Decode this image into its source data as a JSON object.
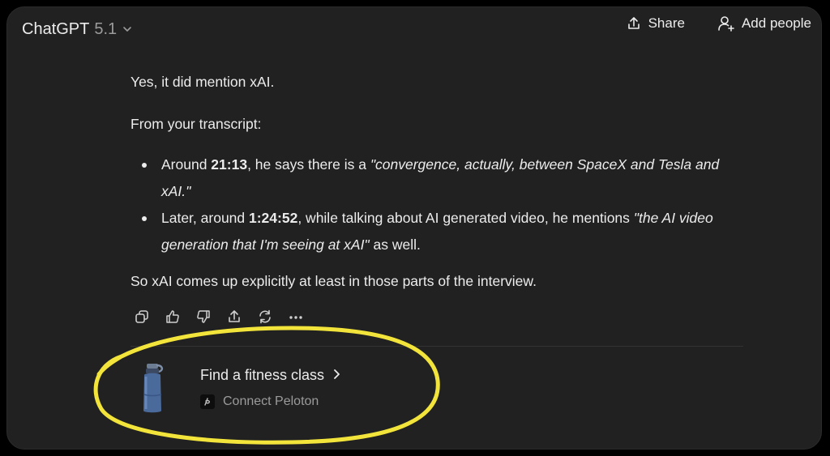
{
  "header": {
    "model_name": "ChatGPT",
    "model_version": "5.1",
    "share_label": "Share",
    "add_people_label": "Add people"
  },
  "message": {
    "p1": "Yes, it did mention xAI.",
    "p2": "From your transcript:",
    "bullets": [
      {
        "prefix": "Around ",
        "time": "21:13",
        "middle": ", he says there is a ",
        "quote": "\"convergence, actually, between SpaceX and Tesla and xAI.\"",
        "suffix": ""
      },
      {
        "prefix": "Later, around ",
        "time": "1:24:52",
        "middle": ", while talking about AI generated video, he mentions ",
        "quote": "\"the AI video generation that I'm seeing at xAI\"",
        "suffix": " as well."
      }
    ],
    "p3": "So xAI comes up explicitly at least in those parts of the interview."
  },
  "actions": [
    "copy-icon",
    "thumbs-up-icon",
    "thumbs-down-icon",
    "share-icon",
    "regenerate-icon",
    "more-icon"
  ],
  "suggestion": {
    "title": "Find a fitness class",
    "subtitle": "Connect Peloton"
  },
  "colors": {
    "background": "#212121",
    "text": "#ececec",
    "muted": "#9b9b9b",
    "highlight": "#f2e43a"
  }
}
